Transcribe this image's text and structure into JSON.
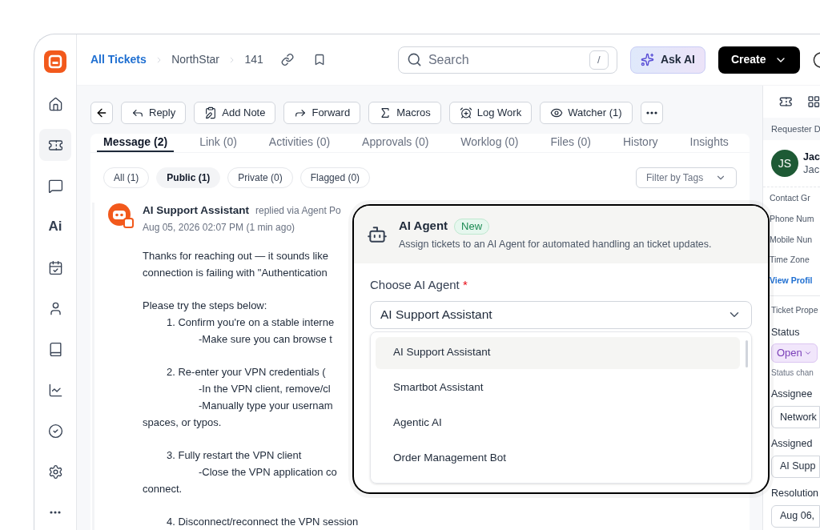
{
  "sidebar": {
    "items": [
      {
        "selected": false
      },
      {
        "selected": true
      },
      {
        "selected": false
      },
      {
        "label": "Ai",
        "selected": false
      },
      {
        "selected": false
      },
      {
        "selected": false
      },
      {
        "selected": false
      },
      {
        "selected": false
      },
      {
        "selected": false
      },
      {
        "selected": false
      },
      {
        "selected": false
      }
    ]
  },
  "breadcrumb": {
    "items": [
      "All Tickets",
      "NorthStar",
      "141"
    ]
  },
  "search": {
    "placeholder": "Search",
    "shortcut": "/"
  },
  "ask_ai": "Ask AI",
  "create": "Create",
  "toolbar": [
    "Reply",
    "Add Note",
    "Forward",
    "Macros",
    "Log Work",
    "Watcher (1)"
  ],
  "tabs": [
    {
      "label": "Message (2)",
      "selected": true
    },
    {
      "label": "Link (0)",
      "selected": false
    },
    {
      "label": "Activities (0)",
      "selected": false
    },
    {
      "label": "Approvals (0)",
      "selected": false
    },
    {
      "label": "Worklog (0)",
      "selected": false
    },
    {
      "label": "Files (0)",
      "selected": false
    },
    {
      "label": "History",
      "selected": false
    },
    {
      "label": "Insights",
      "selected": false
    }
  ],
  "filters": [
    {
      "label": "All (1)",
      "selected": false
    },
    {
      "label": "Public (1)",
      "selected": true
    },
    {
      "label": "Private (0)",
      "selected": false
    },
    {
      "label": "Flagged (0)",
      "selected": false
    }
  ],
  "tag_filter": {
    "placeholder": "Filter by Tags"
  },
  "message": {
    "author": "AI Support Assistant",
    "via": "replied via Agent Po",
    "time": "Aug 05, 2026 02:07 PM (1 min ago)",
    "paragraphs": [
      [
        {
          "kind": "text",
          "text": "Thanks for reaching out — it sounds like"
        },
        {
          "kind": "text",
          "text": "connection is failing with \"Authentication"
        }
      ],
      [
        {
          "kind": "text",
          "text": "Please try the steps below:"
        },
        {
          "kind": "step",
          "text": "1. Confirm you're on a stable interne"
        },
        {
          "kind": "detail",
          "text": "-Make sure you can browse t"
        }
      ],
      [
        {
          "kind": "step",
          "text": "2. Re-enter your VPN credentials ("
        },
        {
          "kind": "detail",
          "text": "-In the VPN client, remove/cl"
        },
        {
          "kind": "detail",
          "text": "-Manually type your usernam"
        },
        {
          "kind": "text",
          "text": "spaces, or typos."
        }
      ],
      [
        {
          "kind": "step",
          "text": "3. Fully restart the VPN client"
        },
        {
          "kind": "detail",
          "text": "-Close the VPN application co"
        },
        {
          "kind": "text",
          "text": "connect."
        }
      ],
      [
        {
          "kind": "step",
          "text": "4. Disconnect/reconnect the VPN session"
        }
      ]
    ]
  },
  "ai_agent_popup": {
    "title": "AI Agent",
    "badge": "New",
    "description": "Assign tickets to an AI Agent for automated handling an ticket updates.",
    "field_label": "Choose AI Agent",
    "required_mark": "*",
    "value": "AI Support Assistant",
    "options": [
      {
        "label": "AI Support Assistant",
        "selected": true
      },
      {
        "label": "Smartbot Assistant",
        "selected": false
      },
      {
        "label": "Agentic AI",
        "selected": false
      },
      {
        "label": "Order Management Bot",
        "selected": false
      }
    ]
  },
  "right_panel": {
    "section_title": "Requester D",
    "requester": {
      "initials": "JS",
      "name": "Jac",
      "subtitle": "Jac"
    },
    "fields": [
      "Contact Gr",
      "Phone Num",
      "Mobile Nun",
      "Time Zone"
    ],
    "link": "View Profil",
    "properties_title": "Ticket Prope",
    "properties": [
      {
        "kind": "status",
        "label": "Status",
        "value": "Open",
        "note": "Status chan"
      },
      {
        "kind": "field",
        "label": "Assignee",
        "value": "Network"
      },
      {
        "kind": "field",
        "label": "Assigned",
        "value": "AI Supp"
      },
      {
        "kind": "field",
        "label": "Resolution",
        "value": "Aug 06,"
      }
    ]
  }
}
